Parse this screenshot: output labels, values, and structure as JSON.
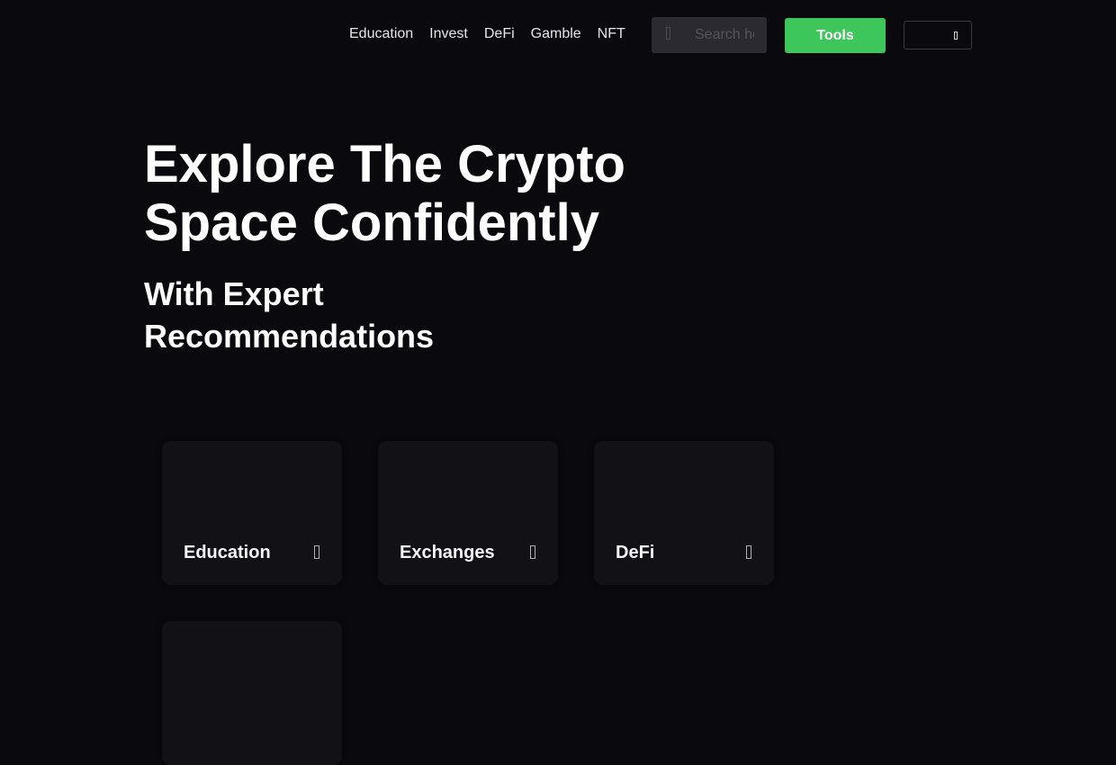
{
  "nav": {
    "links": [
      "Education",
      "Invest",
      "DeFi",
      "Gamble",
      "NFT"
    ],
    "search": {
      "placeholder": "Search here",
      "value": "",
      "icon": "search-icon"
    },
    "tools_label": "Tools",
    "menu_icon": "chevron-down-icon"
  },
  "hero": {
    "title": "Explore The Crypto Space Confidently",
    "subtitle": "With Expert Recommendations"
  },
  "categories": [
    {
      "label": "Education",
      "icon": "arrow-right-icon"
    },
    {
      "label": "Exchanges",
      "icon": "arrow-right-icon"
    },
    {
      "label": "DeFi",
      "icon": "arrow-right-icon"
    },
    {
      "label": "",
      "icon": ""
    }
  ],
  "colors": {
    "background": "#0a090e",
    "card": "#111116",
    "accent": "#3dc65a",
    "search_bg": "#2a2a30"
  }
}
